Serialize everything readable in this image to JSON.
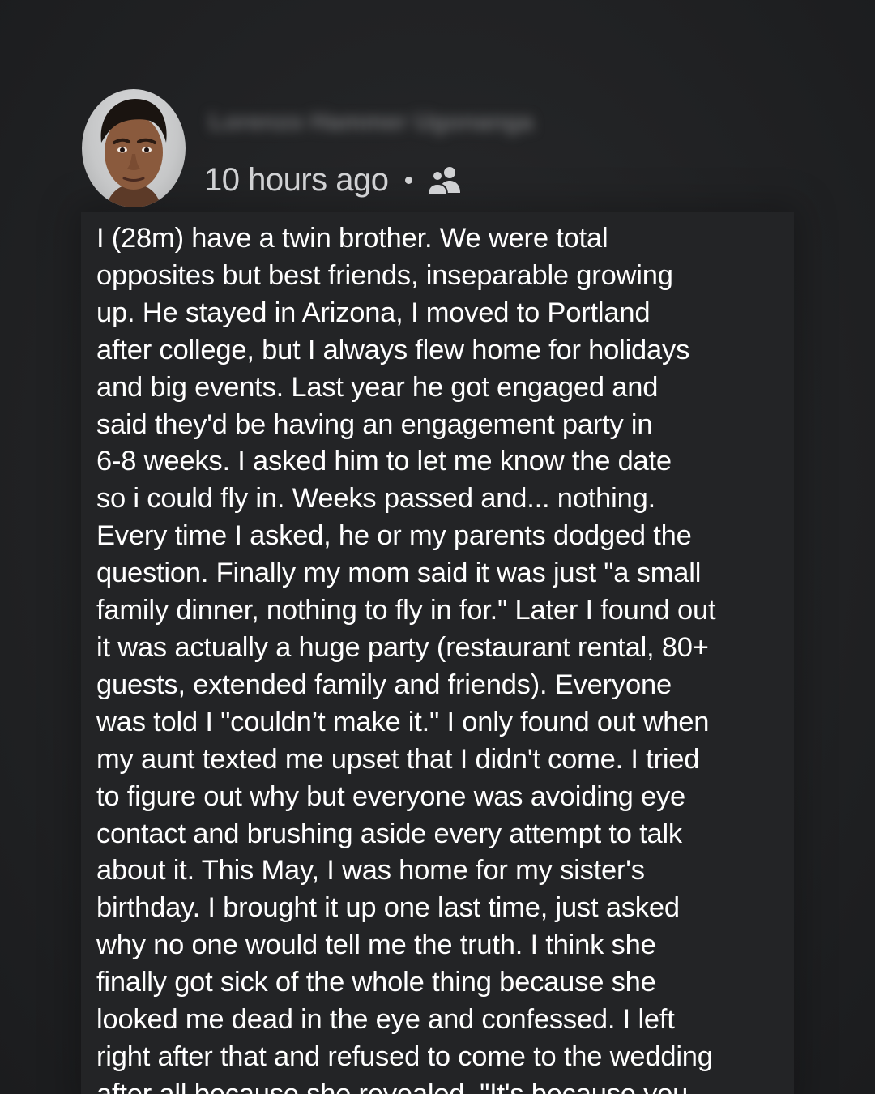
{
  "post": {
    "author_name": "Lorenzo Hammer Ugonanga",
    "timestamp": "10 hours ago",
    "separator": "•",
    "audience_icon": "friends-icon",
    "lines": [
      "I (28m) have a twin brother. We were total",
      "opposites but best friends, inseparable growing",
      "up. He stayed in Arizona, I moved to Portland",
      "after college, but I always flew home for holidays",
      "and big events. Last year he got engaged and",
      "said they'd be having an engagement party in",
      "6-8 weeks. I asked him to let me know the date",
      "so i could fly in. Weeks passed and... nothing.",
      "Every time I asked, he or my parents dodged the",
      "question. Finally my mom said it was just \"a small",
      "family dinner, nothing to fly in for.\" Later I found out",
      "it was actually a huge party (restaurant rental, 80+",
      "guests, extended family and friends). Everyone",
      "was told I \"couldn’t make it.\" I only found out when",
      "my aunt texted me upset that I didn't come. I tried",
      "to figure out why but everyone was avoiding eye",
      "contact and brushing aside every attempt to talk",
      "about it. This May, I was home for my sister's",
      "birthday. I brought it up one last time, just asked",
      "why no one would tell me the truth. I think she",
      "finally got sick of the whole thing because she",
      "looked me dead in the eye and confessed. I left",
      "right after that and refused to come to the wedding",
      "after all because she revealed, \"It's because you"
    ]
  },
  "colors": {
    "background": "#1e1f21",
    "card": "#232426",
    "text": "#ffffff",
    "meta_text": "#d0d1d3"
  }
}
